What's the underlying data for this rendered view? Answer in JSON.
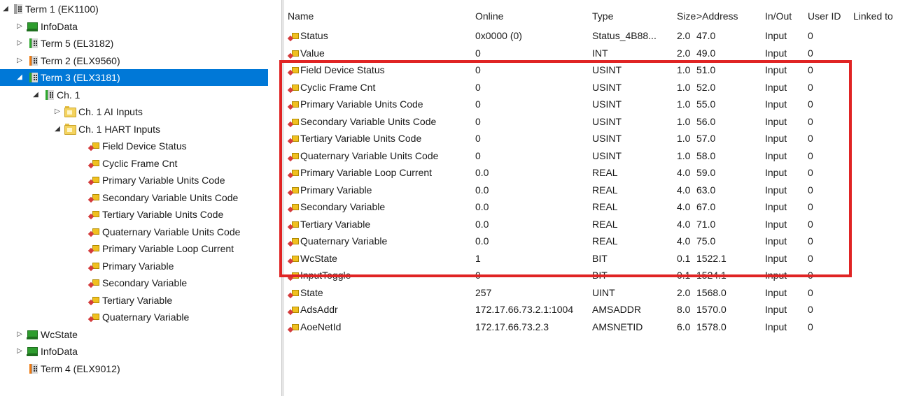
{
  "tree": [
    {
      "label": "Term 1 (EK1100)",
      "level": 0,
      "icon": "terminal-icon",
      "icon_color": "#a0a0a0",
      "expand": "expanded",
      "selected": false
    },
    {
      "label": "InfoData",
      "level": 1,
      "icon": "monitor-icon",
      "expand": "collapsed",
      "selected": false
    },
    {
      "label": "Term 5 (EL3182)",
      "level": 1,
      "icon": "terminal-icon",
      "icon_color": "#2eaa2e",
      "expand": "collapsed",
      "selected": false
    },
    {
      "label": "Term 2 (ELX9560)",
      "level": 1,
      "icon": "terminal-icon",
      "icon_color": "#f07a10",
      "expand": "collapsed",
      "selected": false
    },
    {
      "label": "Term 3 (ELX3181)",
      "level": 1,
      "icon": "terminal-icon",
      "icon_color": "#2eaa2e",
      "expand": "expanded",
      "selected": true
    },
    {
      "label": "Ch. 1",
      "level": 2,
      "icon": "terminal-icon",
      "icon_color": "#2eaa2e",
      "expand": "expanded",
      "selected": false
    },
    {
      "label": "Ch. 1 AI Inputs",
      "level": 3,
      "icon": "folder-icon",
      "expand": "collapsed",
      "selected": false
    },
    {
      "label": "Ch. 1 HART Inputs",
      "level": 3,
      "icon": "folder-icon",
      "expand": "expanded",
      "selected": false
    },
    {
      "label": "Field Device Status",
      "level": 4,
      "icon": "variable-icon",
      "expand": "none",
      "selected": false
    },
    {
      "label": "Cyclic Frame Cnt",
      "level": 4,
      "icon": "variable-icon",
      "expand": "none",
      "selected": false
    },
    {
      "label": "Primary Variable Units Code",
      "level": 4,
      "icon": "variable-icon",
      "expand": "none",
      "selected": false
    },
    {
      "label": "Secondary Variable Units Code",
      "level": 4,
      "icon": "variable-icon",
      "expand": "none",
      "selected": false
    },
    {
      "label": "Tertiary Variable Units Code",
      "level": 4,
      "icon": "variable-icon",
      "expand": "none",
      "selected": false
    },
    {
      "label": "Quaternary Variable Units Code",
      "level": 4,
      "icon": "variable-icon",
      "expand": "none",
      "selected": false
    },
    {
      "label": "Primary Variable Loop Current",
      "level": 4,
      "icon": "variable-icon",
      "expand": "none",
      "selected": false
    },
    {
      "label": "Primary Variable",
      "level": 4,
      "icon": "variable-icon",
      "expand": "none",
      "selected": false
    },
    {
      "label": "Secondary Variable",
      "level": 4,
      "icon": "variable-icon",
      "expand": "none",
      "selected": false
    },
    {
      "label": "Tertiary Variable",
      "level": 4,
      "icon": "variable-icon",
      "expand": "none",
      "selected": false
    },
    {
      "label": "Quaternary Variable",
      "level": 4,
      "icon": "variable-icon",
      "expand": "none",
      "selected": false
    },
    {
      "label": "WcState",
      "level": 1,
      "icon": "monitor-icon",
      "expand": "collapsed",
      "selected": false
    },
    {
      "label": "InfoData",
      "level": 1,
      "icon": "monitor-icon",
      "expand": "collapsed",
      "selected": false
    },
    {
      "label": "Term 4 (ELX9012)",
      "level": 1,
      "icon": "terminal-icon",
      "icon_color": "#f07a10",
      "expand": "none",
      "selected": false
    }
  ],
  "columns": [
    "Name",
    "Online",
    "Type",
    "Size",
    ">Address",
    "In/Out",
    "User ID",
    "Linked to"
  ],
  "rows": [
    {
      "name": "Status",
      "online": "0x0000 (0)",
      "type": "Status_4B88...",
      "size": "2.0",
      "address": "47.0",
      "inout": "Input",
      "userid": "0",
      "linked": ""
    },
    {
      "name": "Value",
      "online": "0",
      "type": "INT",
      "size": "2.0",
      "address": "49.0",
      "inout": "Input",
      "userid": "0",
      "linked": ""
    },
    {
      "name": "Field Device Status",
      "online": "0",
      "type": "USINT",
      "size": "1.0",
      "address": "51.0",
      "inout": "Input",
      "userid": "0",
      "linked": ""
    },
    {
      "name": "Cyclic Frame Cnt",
      "online": "0",
      "type": "USINT",
      "size": "1.0",
      "address": "52.0",
      "inout": "Input",
      "userid": "0",
      "linked": ""
    },
    {
      "name": "Primary Variable Units Code",
      "online": "0",
      "type": "USINT",
      "size": "1.0",
      "address": "55.0",
      "inout": "Input",
      "userid": "0",
      "linked": ""
    },
    {
      "name": "Secondary Variable Units Code",
      "online": "0",
      "type": "USINT",
      "size": "1.0",
      "address": "56.0",
      "inout": "Input",
      "userid": "0",
      "linked": ""
    },
    {
      "name": "Tertiary Variable Units Code",
      "online": "0",
      "type": "USINT",
      "size": "1.0",
      "address": "57.0",
      "inout": "Input",
      "userid": "0",
      "linked": ""
    },
    {
      "name": "Quaternary Variable Units Code",
      "online": "0",
      "type": "USINT",
      "size": "1.0",
      "address": "58.0",
      "inout": "Input",
      "userid": "0",
      "linked": ""
    },
    {
      "name": "Primary Variable Loop Current",
      "online": "0.0",
      "type": "REAL",
      "size": "4.0",
      "address": "59.0",
      "inout": "Input",
      "userid": "0",
      "linked": ""
    },
    {
      "name": "Primary Variable",
      "online": "0.0",
      "type": "REAL",
      "size": "4.0",
      "address": "63.0",
      "inout": "Input",
      "userid": "0",
      "linked": ""
    },
    {
      "name": "Secondary Variable",
      "online": "0.0",
      "type": "REAL",
      "size": "4.0",
      "address": "67.0",
      "inout": "Input",
      "userid": "0",
      "linked": ""
    },
    {
      "name": "Tertiary Variable",
      "online": "0.0",
      "type": "REAL",
      "size": "4.0",
      "address": "71.0",
      "inout": "Input",
      "userid": "0",
      "linked": ""
    },
    {
      "name": "Quaternary Variable",
      "online": "0.0",
      "type": "REAL",
      "size": "4.0",
      "address": "75.0",
      "inout": "Input",
      "userid": "0",
      "linked": ""
    },
    {
      "name": "WcState",
      "online": "1",
      "type": "BIT",
      "size": "0.1",
      "address": "1522.1",
      "inout": "Input",
      "userid": "0",
      "linked": ""
    },
    {
      "name": "InputToggle",
      "online": "0",
      "type": "BIT",
      "size": "0.1",
      "address": "1524.1",
      "inout": "Input",
      "userid": "0",
      "linked": ""
    },
    {
      "name": "State",
      "online": "257",
      "type": "UINT",
      "size": "2.0",
      "address": "1568.0",
      "inout": "Input",
      "userid": "0",
      "linked": ""
    },
    {
      "name": "AdsAddr",
      "online": "172.17.66.73.2.1:1004",
      "type": "AMSADDR",
      "size": "8.0",
      "address": "1570.0",
      "inout": "Input",
      "userid": "0",
      "linked": ""
    },
    {
      "name": "AoeNetId",
      "online": "172.17.66.73.2.3",
      "type": "AMSNETID",
      "size": "6.0",
      "address": "1578.0",
      "inout": "Input",
      "userid": "0",
      "linked": ""
    }
  ],
  "colors": {
    "selection": "#0078d7",
    "highlight_border": "#e02424"
  }
}
